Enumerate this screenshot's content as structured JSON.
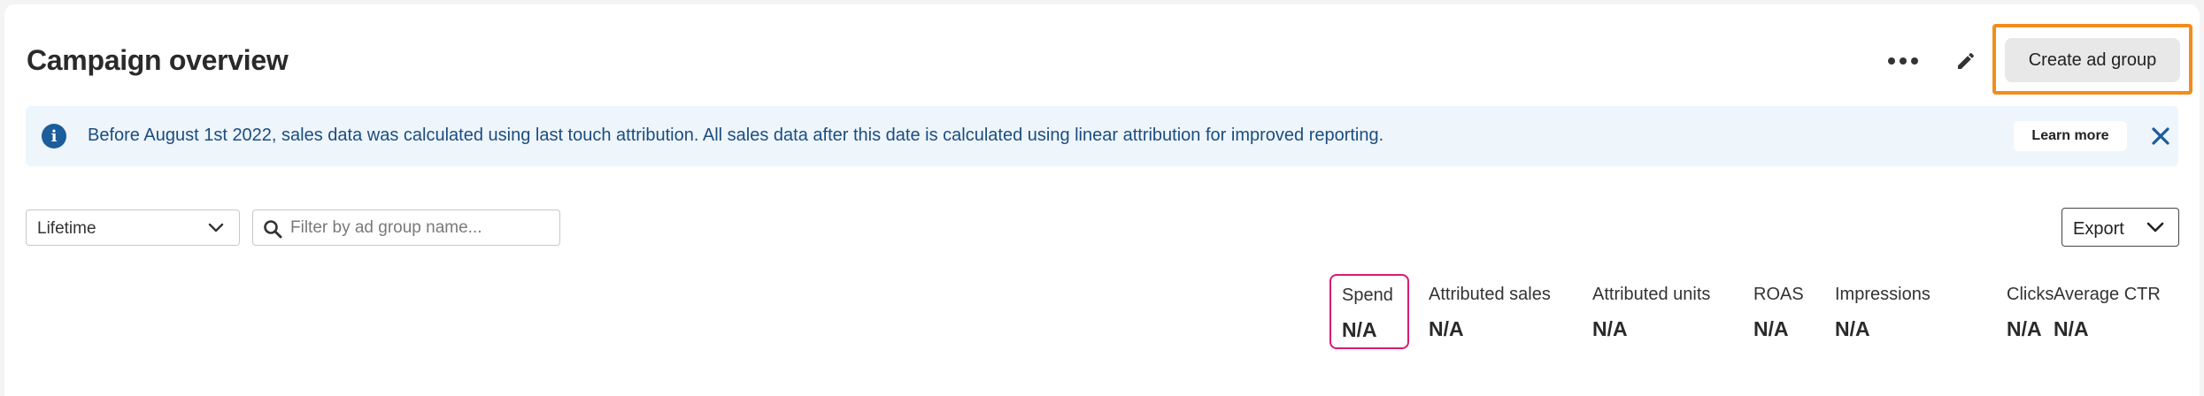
{
  "header": {
    "title": "Campaign overview",
    "more_icon": "more-horizontal-icon",
    "edit_icon": "pencil-icon",
    "create_label": "Create ad group",
    "highlight_color": "#f28c1e"
  },
  "banner": {
    "icon": "info-icon",
    "icon_glyph": "i",
    "message": "Before August 1st 2022, sales data was calculated using last touch attribution. All sales data after this date is calculated using linear attribution for improved reporting.",
    "learn_more_label": "Learn more",
    "close_icon": "close-icon",
    "background": "#eef5fb",
    "text_color": "#1c4d80"
  },
  "filters": {
    "date_range": {
      "selected": "Lifetime"
    },
    "search": {
      "placeholder": "Filter by ad group name...",
      "value": ""
    },
    "export_label": "Export"
  },
  "metrics": [
    {
      "label": "Spend",
      "value": "N/A",
      "selected": true
    },
    {
      "label": "Attributed sales",
      "value": "N/A",
      "selected": false
    },
    {
      "label": "Attributed units",
      "value": "N/A",
      "selected": false
    },
    {
      "label": "ROAS",
      "value": "N/A",
      "selected": false
    },
    {
      "label": "Impressions",
      "value": "N/A",
      "selected": false
    },
    {
      "label": "Clicks",
      "value": "N/A",
      "selected": false
    },
    {
      "label": "Average CTR",
      "value": "N/A",
      "selected": false
    }
  ],
  "colors": {
    "selected_metric_border": "#d81b72",
    "info_blue": "#1c5d9b"
  }
}
